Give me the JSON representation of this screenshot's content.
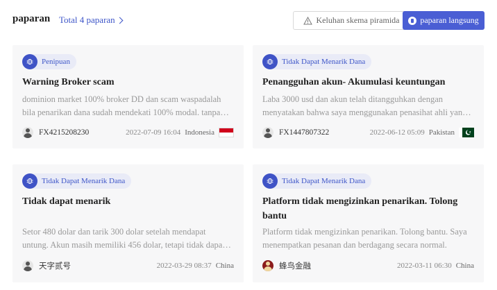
{
  "header": {
    "title": "paparan",
    "total_link": "Total 4 paparan",
    "pyramid_button": "Keluhan skema piramida",
    "direct_button": "paparan langsung"
  },
  "cards": [
    {
      "tag": "Penipuan",
      "title": "Warning Broker scam",
      "desc": "dominion market 100% broker DD dan scam waspadalah bila penarikan dana sudah mendekati 100% modal. tanpa…",
      "user": "FX4215208230",
      "time": "2022-07-09 16:04",
      "country": "Indonesia",
      "flag": "indonesia-flag"
    },
    {
      "tag": "Tidak Dapat Menarik Dana",
      "title": "Penangguhan akun- Akumulasi keuntungan",
      "desc": "Laba 3000 usd dan akun telah ditangguhkan dengan menyatakan bahwa saya menggunakan penasihat ahli yan…",
      "user": "FX1447807322",
      "time": "2022-06-12 05:09",
      "country": "Pakistan",
      "flag": "pakistan-flag"
    },
    {
      "tag": "Tidak Dapat Menarik Dana",
      "title": "Tidak dapat menarik",
      "desc": "Setor 480 dolar dan tarik 300 dolar setelah mendapat untung. Akun masih memiliki 456 dolar, tetapi tidak dapa…",
      "user": "天字贰号",
      "time": "2022-03-29 08:37",
      "country": "China"
    },
    {
      "tag": "Tidak Dapat Menarik Dana",
      "title": "Platform tidak mengizinkan penarikan. Tolong bantu",
      "desc": "Platform tidak mengizinkan penarikan. Tolong bantu. Saya menempatkan pesanan dan berdagang secara normal.",
      "user": "蜂鸟金融",
      "time": "2022-03-11 06:30",
      "country": "China"
    }
  ],
  "colors": {
    "accent": "#4a5ed4",
    "tag_bg": "#e9ebf7",
    "card_bg": "#f7f7f8"
  }
}
